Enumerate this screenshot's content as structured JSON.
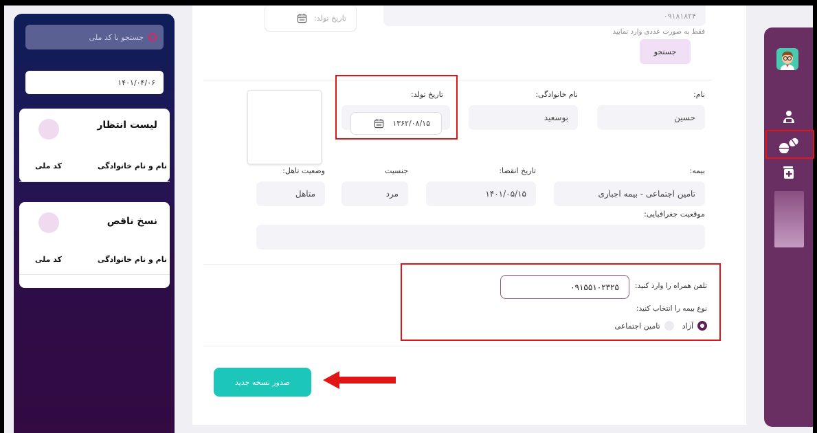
{
  "sidebar": {
    "search_placeholder": "جستجو با کد ملی",
    "date": "۱۴۰۱/۰۴/۰۶",
    "waitlist": {
      "title": "لیست انتظار",
      "col_name": "نام و نام خانوادگی",
      "col_id": "کد ملی"
    },
    "incomplete": {
      "title": "نسخ ناقص",
      "col_name": "نام و نام خانوادگی",
      "col_id": "کد ملی"
    }
  },
  "search_section": {
    "birth_date_placeholder": "تاریخ تولد:",
    "national_id_value": "۰۹۱۸۱۸۲۴",
    "hint": "فقط به صورت عددی وارد نمایید",
    "search_label": "جستجو"
  },
  "patient": {
    "name_label": "نام:",
    "name_value": "حسین",
    "family_label": "نام خانوادگی:",
    "family_value": "بوسعید",
    "birth_label": "تاریخ تولد:",
    "birth_value": "۱۳۶۲/۰۸/۱۵",
    "insurance_label": "بیمه:",
    "insurance_value": "تامین اجتماعی - بیمه اجباری",
    "expiry_label": "تاریخ انقضا:",
    "expiry_value": "۱۴۰۱/۰۵/۱۵",
    "gender_label": "جنسیت",
    "gender_value": "مرد",
    "marital_label": "وضعیت تاهل:",
    "marital_value": "متاهل",
    "geo_label": "موقعیت جغرافیایی:"
  },
  "contact": {
    "phone_label": "تلفن همراه را وارد کنید:",
    "phone_value": "۰۹۱۵۵۱۰۲۳۲۵",
    "insurance_type_label": "نوع بیمه را انتخاب کنید:",
    "option_free": "آزاد",
    "option_social": "تامین اجتماعی",
    "selected": "آزاد"
  },
  "actions": {
    "issue_label": "صدور نسخه جدید"
  },
  "colors": {
    "accent_teal": "#1cc6b8",
    "highlight_red": "#e01515",
    "rail_purple": "#6a2f62"
  },
  "icons": [
    "search-icon",
    "calendar-icon",
    "doctor-avatar-icon",
    "user-icon",
    "pills-icon",
    "add-prescription-icon",
    "arrow-left-icon"
  ]
}
